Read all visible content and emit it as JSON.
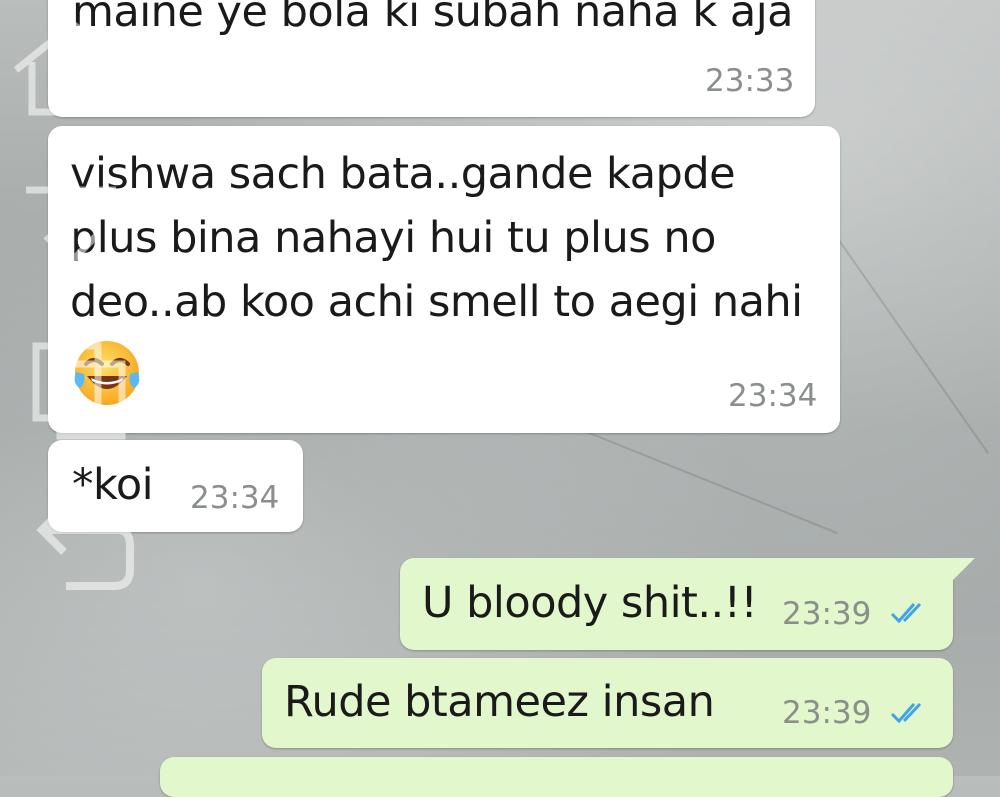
{
  "messages": [
    {
      "direction": "incoming",
      "text": "maine ye bola ki subah naha k aja",
      "time": "23:33"
    },
    {
      "direction": "incoming",
      "text": "vishwa sach bata..gande kapde\nplus bina nahayi hui tu plus no\ndeo..ab koo achi smell to aegi nahi",
      "emoji": "face-with-tears-of-joy",
      "time": "23:34"
    },
    {
      "direction": "incoming",
      "text": "*koi",
      "time": "23:34"
    },
    {
      "direction": "outgoing",
      "text": "U bloody shit..!!",
      "time": "23:39",
      "status": "read"
    },
    {
      "direction": "outgoing",
      "text": "Rude btameez insan",
      "time": "23:39",
      "status": "read"
    }
  ],
  "colors": {
    "incoming_bubble": "#ffffff",
    "outgoing_bubble": "#e2f7cb",
    "read_ticks": "#3fa4e8",
    "timestamp": "#8a8f8c"
  },
  "overlay_icons": [
    "home-icon",
    "download-icon",
    "copy-icon",
    "back-icon"
  ]
}
